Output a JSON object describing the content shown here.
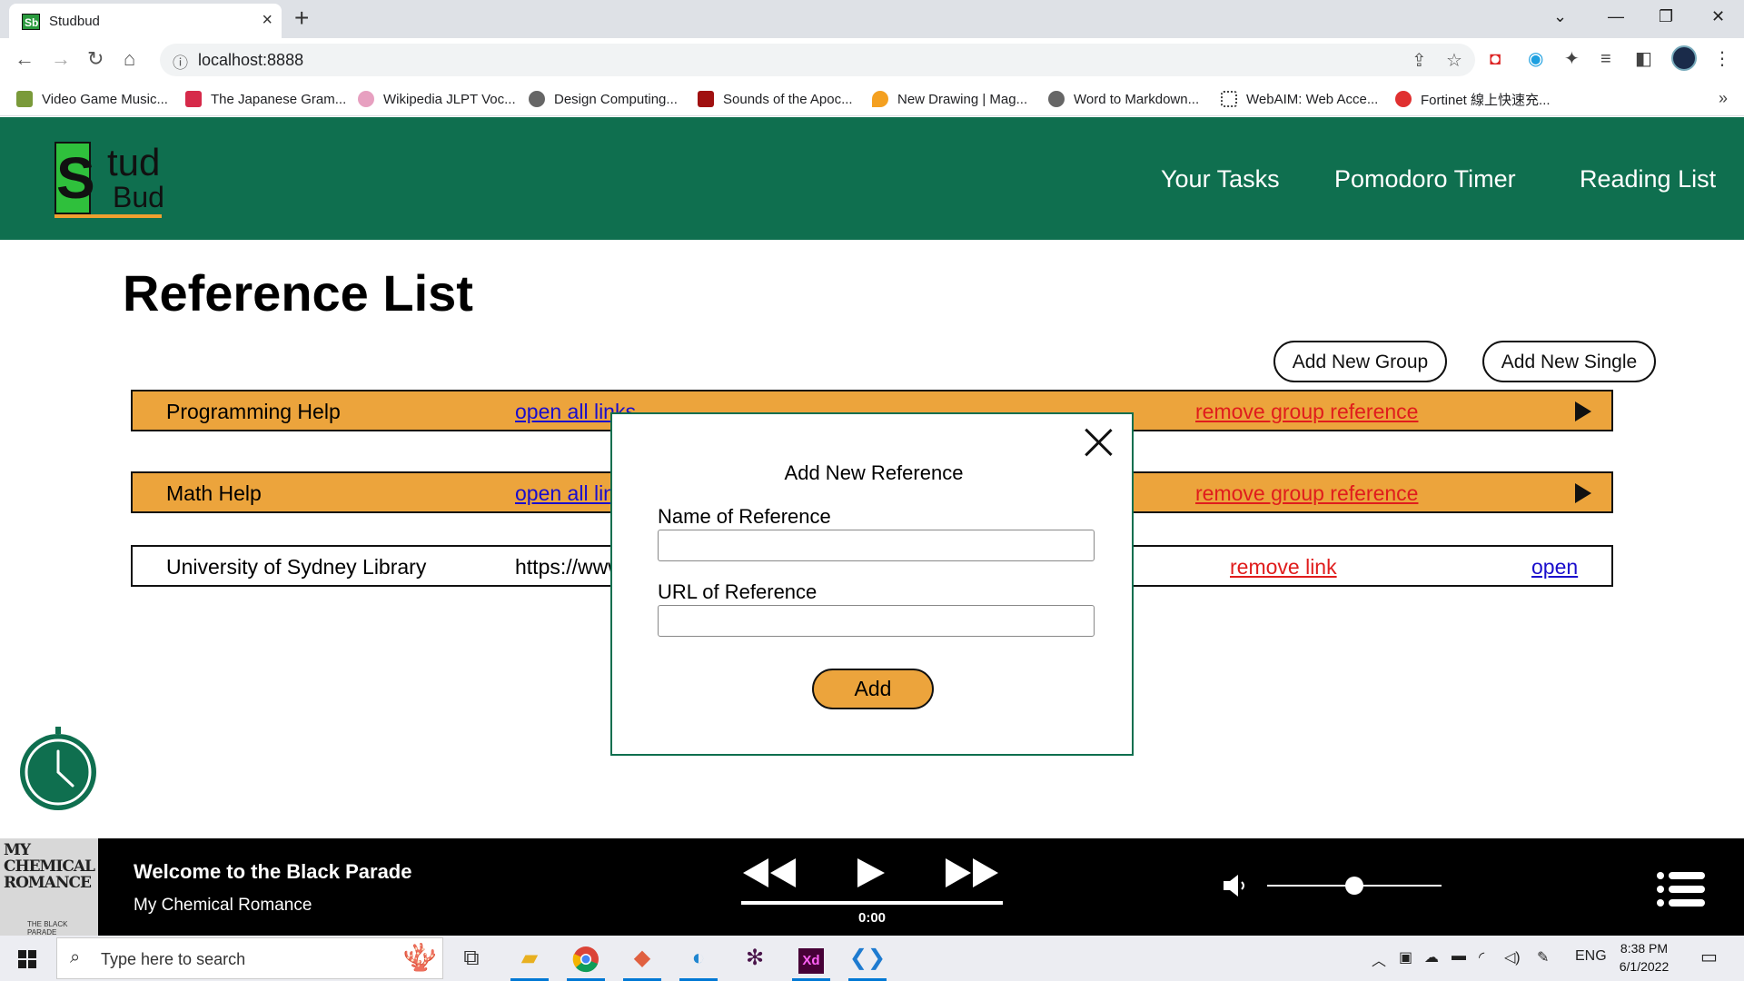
{
  "browser": {
    "tab_title": "Studbud",
    "tab_favicon": "Sb",
    "url": "localhost:8888",
    "bookmarks": [
      {
        "label": "Video Game Music...",
        "color": "#7a9a3a"
      },
      {
        "label": "The Japanese Gram...",
        "color": "#d62a4a"
      },
      {
        "label": "Wikipedia JLPT Voc...",
        "color": "#e7a0c0"
      },
      {
        "label": "Design Computing...",
        "color": "#555555"
      },
      {
        "label": "Sounds of the Apoc...",
        "color": "#a01010"
      },
      {
        "label": "New Drawing | Mag...",
        "color": "#f4a020"
      },
      {
        "label": "Word to Markdown...",
        "color": "#555555"
      },
      {
        "label": "WebAIM: Web Acce...",
        "color": "#444444"
      },
      {
        "label": "Fortinet 線上快速充...",
        "color": "#e03030"
      }
    ]
  },
  "site": {
    "logo": {
      "s": "S",
      "tud": "tud",
      "bud": "Bud"
    },
    "nav": [
      "Your Tasks",
      "Pomodoro Timer",
      "Reading List"
    ],
    "colors": {
      "header": "#0f6f4f",
      "accent": "#eca43c",
      "link": "#1a0dcc",
      "remove": "#e01c1c"
    }
  },
  "page": {
    "title": "Reference List",
    "add_group_label": "Add New Group",
    "add_single_label": "Add New Single",
    "rows": [
      {
        "type": "group",
        "name": "Programming Help",
        "link": "open all links",
        "remove": "remove group reference"
      },
      {
        "type": "group",
        "name": "Math Help",
        "link": "open all links",
        "remove": "remove group reference"
      },
      {
        "type": "single",
        "name": "University of Sydney Library",
        "url": "https://www.library.sydney.edu.au",
        "remove": "remove link",
        "open": "open"
      }
    ]
  },
  "modal": {
    "title": "Add New Reference",
    "name_label": "Name of Reference",
    "name_value": "",
    "url_label": "URL of Reference",
    "url_value": "",
    "add_label": "Add"
  },
  "player": {
    "song": "Welcome to the Black Parade",
    "artist": "My Chemical Romance",
    "album_art_text": "MY CHEMICAL ROMANCE",
    "album_art_small": "THE BLACK PARADE",
    "time": "0:00",
    "progress": 0.0,
    "volume": 0.5
  },
  "taskbar": {
    "search_placeholder": "Type here to search",
    "language": "ENG",
    "time": "8:38 PM",
    "date": "6/1/2022"
  }
}
